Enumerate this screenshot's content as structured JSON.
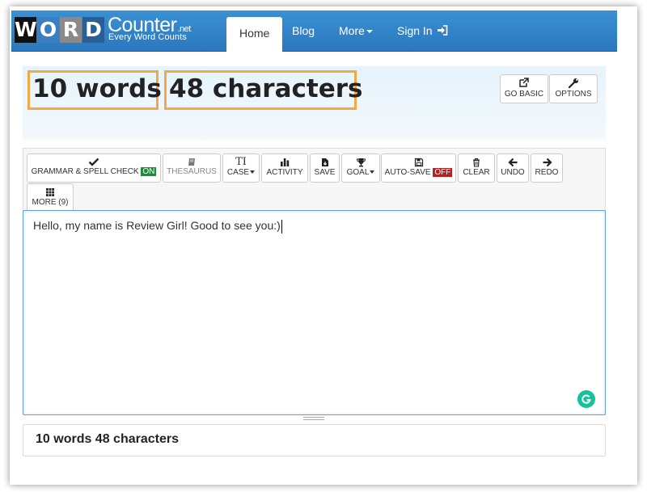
{
  "logo": {
    "letters": [
      "W",
      "O",
      "R",
      "D"
    ],
    "letter_colors": [
      "#111111",
      "#3a7fc4",
      "#8a8a8a",
      "#2a5f96"
    ],
    "counter": "Counter",
    "net": ".net",
    "tagline": "Every Word Counts"
  },
  "nav": {
    "home": "Home",
    "blog": "Blog",
    "more": "More",
    "sign_in": "Sign In"
  },
  "stats": {
    "words": "10 words",
    "characters": "48 characters"
  },
  "top_buttons": {
    "go_basic": "GO BASIC",
    "options": "OPTIONS"
  },
  "toolbar": {
    "grammar": "GRAMMAR & SPELL CHECK",
    "grammar_state": "ON",
    "thesaurus": "THESAURUS",
    "case_icon": "TI",
    "case": "CASE",
    "activity": "ACTIVITY",
    "save": "SAVE",
    "goal": "GOAL",
    "auto_save": "AUTO-SAVE",
    "auto_save_state": "OFF",
    "clear": "CLEAR",
    "undo": "UNDO",
    "redo": "REDO",
    "more": "MORE (9)"
  },
  "editor": {
    "text": "Hello, my name is Review Girl! Good to see you:)"
  },
  "summary": "10 words 48 characters",
  "colors": {
    "nav_blue": "#2f82c8",
    "highlight_orange": "#f5a742",
    "on_green": "#1f8a3a",
    "off_red": "#b22222",
    "grammarly_green": "#15c39a"
  }
}
